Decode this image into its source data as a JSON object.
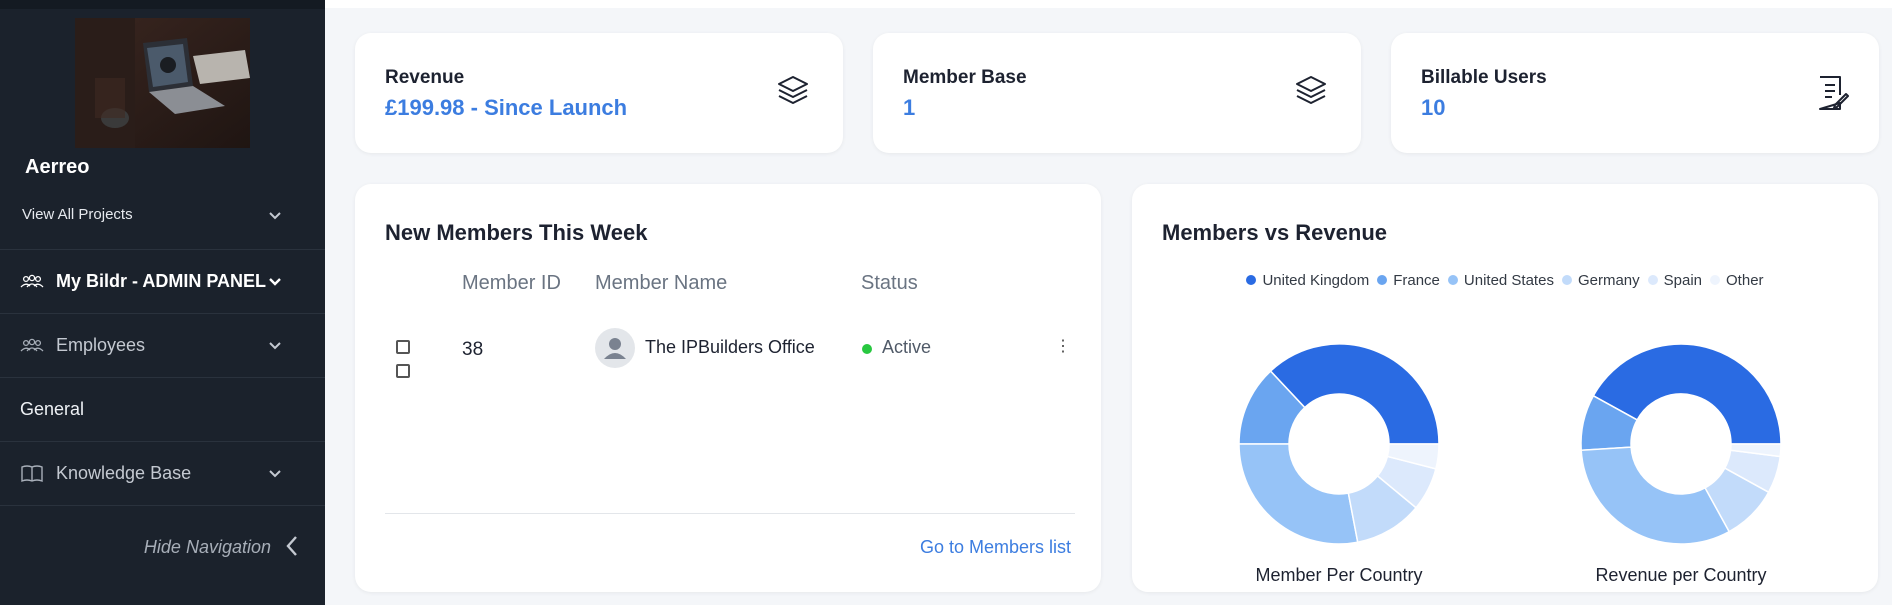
{
  "sidebar": {
    "project_name": "Aerreo",
    "view_all_label": "View All Projects",
    "items": [
      {
        "label": "My Bildr - ADMIN PANEL"
      },
      {
        "label": "Employees"
      },
      {
        "label": "General"
      },
      {
        "label": "Knowledge Base"
      }
    ],
    "hide_nav_label": "Hide Navigation"
  },
  "stats": [
    {
      "label": "Revenue",
      "value": "£199.98 - Since Launch"
    },
    {
      "label": "Member Base",
      "value": "1"
    },
    {
      "label": "Billable Users",
      "value": "10"
    }
  ],
  "members_card": {
    "title": "New Members This Week",
    "columns": {
      "id": "Member ID",
      "name": "Member Name",
      "status": "Status"
    },
    "rows": [
      {
        "id": "38",
        "name": "The IPBuilders Office",
        "status": "Active"
      }
    ],
    "link": "Go to Members list"
  },
  "chart_card": {
    "title": "Members vs Revenue"
  },
  "colors": {
    "accent": "#3c7de0",
    "sidebar_bg": "#1b222c",
    "active_status": "#28c840"
  },
  "chart_data": [
    {
      "type": "pie",
      "title": "Member Per Country",
      "categories": [
        "United Kingdom",
        "France",
        "United States",
        "Germany",
        "Spain",
        "Other"
      ],
      "colors": [
        "#2a6be3",
        "#6aa5f0",
        "#96c3f7",
        "#c2dbfa",
        "#dce9fc",
        "#eef4fd"
      ],
      "values": [
        37,
        13,
        28,
        11,
        7,
        4
      ],
      "donut": true,
      "legend": "top"
    },
    {
      "type": "pie",
      "title": "Revenue per Country",
      "categories": [
        "United Kingdom",
        "France",
        "United States",
        "Germany",
        "Spain",
        "Other"
      ],
      "colors": [
        "#2a6be3",
        "#6aa5f0",
        "#96c3f7",
        "#c2dbfa",
        "#dce9fc",
        "#eef4fd"
      ],
      "values": [
        42,
        9,
        32,
        9,
        6,
        2
      ],
      "donut": true,
      "legend": "top"
    }
  ]
}
